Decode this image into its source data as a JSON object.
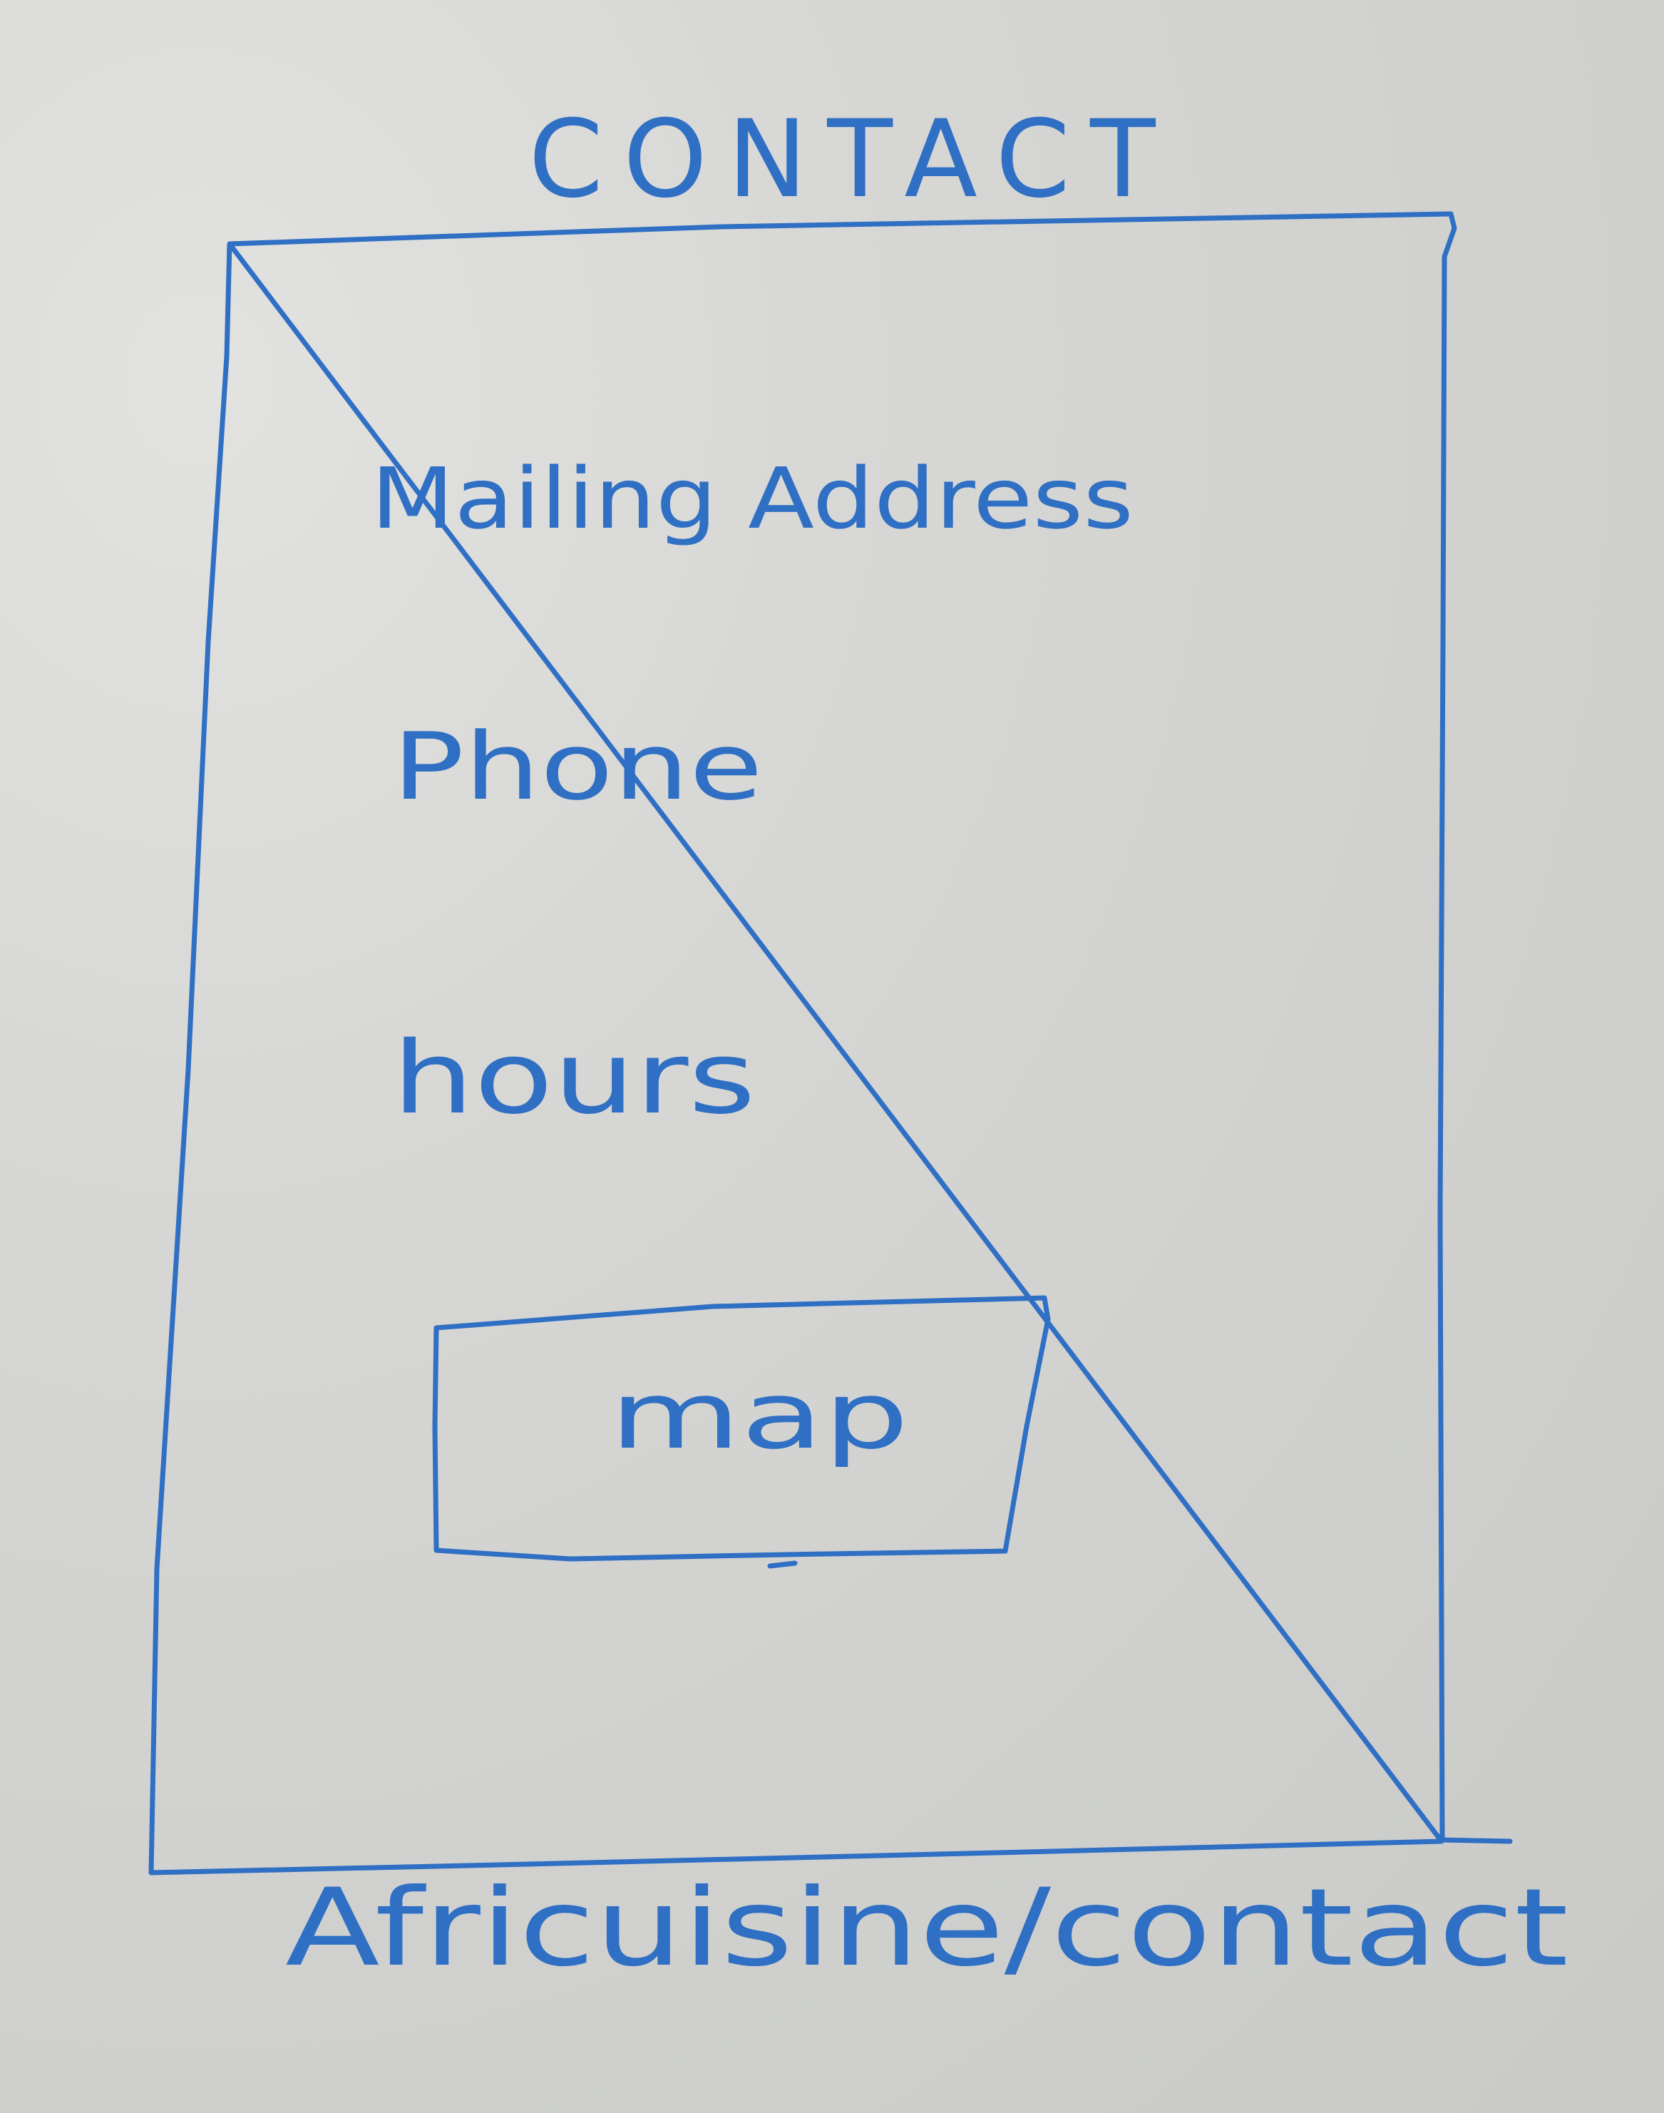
{
  "sketch": {
    "page_title": "CONTACT",
    "fields": [
      {
        "label": "Mailing Address"
      },
      {
        "label": "Phone"
      },
      {
        "label": "hours"
      }
    ],
    "map_label": "map",
    "url_caption": "Africuisine/contact"
  },
  "colors": {
    "ink": "#2f6fc4",
    "whiteboard": "#d6d6d4"
  }
}
